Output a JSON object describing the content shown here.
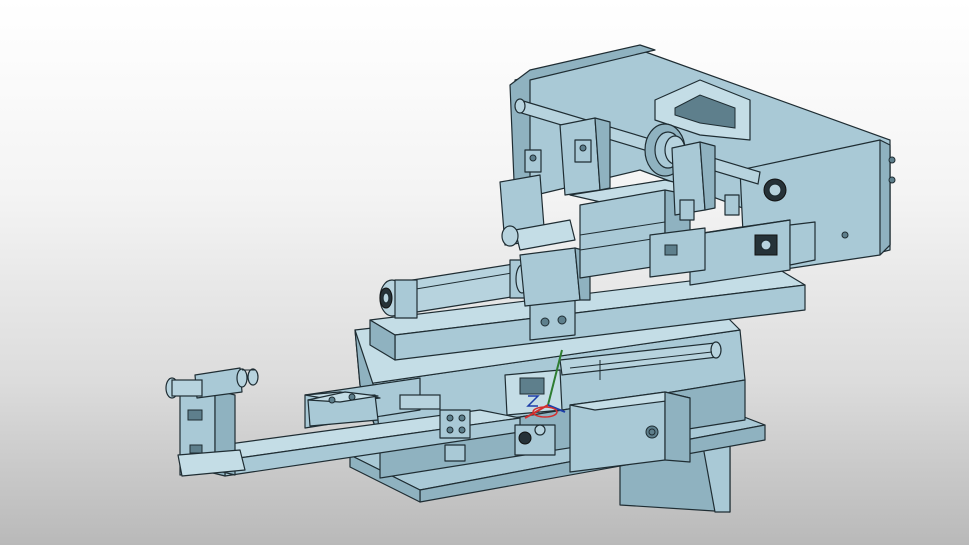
{
  "scene": {
    "background_top": "#ffffff",
    "background_bottom": "#b9b9b9",
    "part_color": "#a9c9d6",
    "edge_color": "#1f2d33"
  },
  "triad": {
    "x_color": "#d32f2f",
    "y_color": "#2e7d32",
    "z_color": "#1e3fa8"
  }
}
